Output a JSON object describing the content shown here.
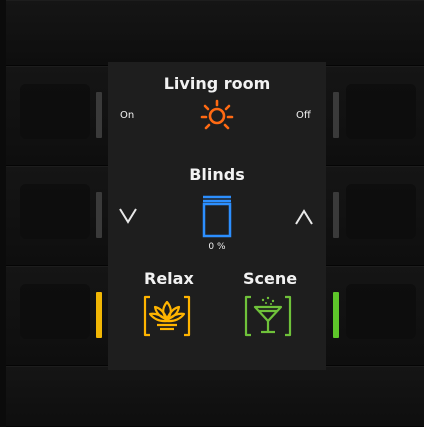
{
  "screen": {
    "room_title": "Living room",
    "on_label": "On",
    "off_label": "Off",
    "blinds_title": "Blinds",
    "blinds_value": "0 %",
    "scene1_label": "Relax",
    "scene2_label": "Scene"
  },
  "colors": {
    "light_icon": "#ff6a13",
    "blinds_icon": "#2c8fff",
    "relax_icon": "#ffb400",
    "scene_icon": "#6fc23a",
    "led_left_bottom": "#f2b705",
    "led_right_bottom": "#5ec62a",
    "led_gray": "#3a3a3a"
  },
  "icons": {
    "light": "light-bulb-icon",
    "blinds": "blinds-icon",
    "down": "chevron-down-icon",
    "up": "chevron-up-icon",
    "relax": "lotus-icon",
    "scene": "cocktail-icon"
  }
}
